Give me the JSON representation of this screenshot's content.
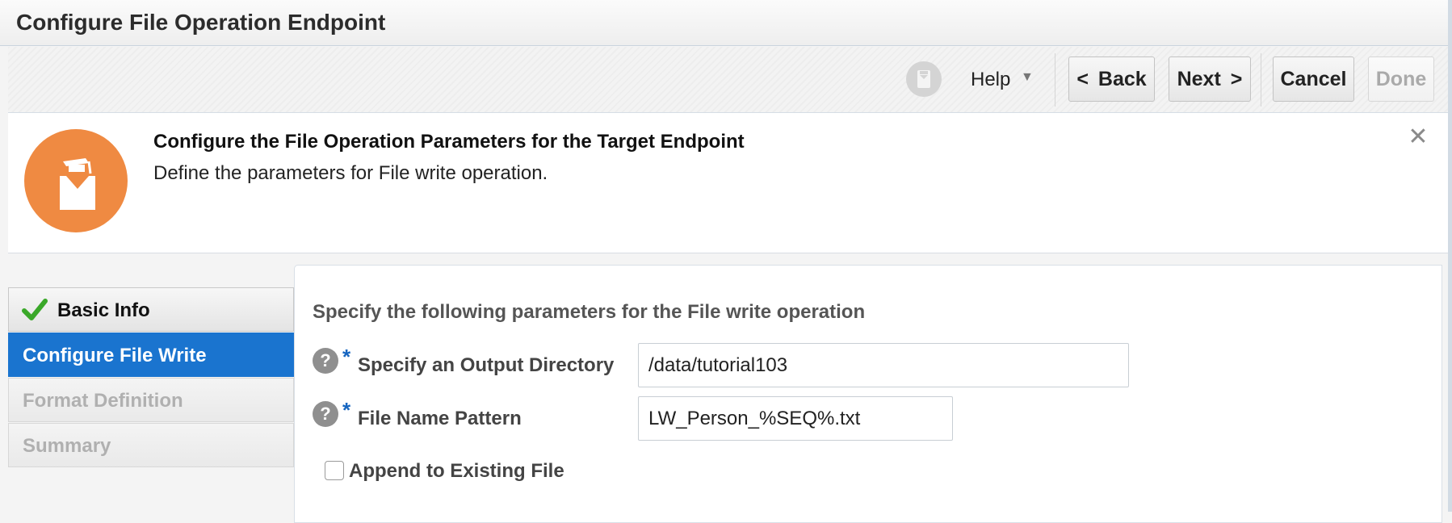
{
  "window": {
    "title": "Configure File Operation Endpoint"
  },
  "toolbar": {
    "user_icon": "user-badge-icon",
    "help_label": "Help",
    "help_caret": "▼",
    "back_label": "Back",
    "back_arrow": "<",
    "next_label": "Next",
    "next_arrow": ">",
    "cancel_label": "Cancel",
    "done_label": "Done"
  },
  "banner": {
    "icon": "graduation-cap-icon",
    "icon_color": "#ef8a42",
    "title": "Configure the File Operation Parameters for the Target Endpoint",
    "description": "Define the parameters for File write operation.",
    "close": "✕"
  },
  "steps": [
    {
      "label": "Basic Info",
      "state": "completed"
    },
    {
      "label": "Configure File Write",
      "state": "active"
    },
    {
      "label": "Format Definition",
      "state": "disabled"
    },
    {
      "label": "Summary",
      "state": "disabled"
    }
  ],
  "form": {
    "heading": "Specify the following parameters for the File write operation",
    "required_marker": "*",
    "help_glyph": "?",
    "output_directory": {
      "label": "Specify an Output Directory",
      "value": "/data/tutorial103"
    },
    "file_name_pattern": {
      "label": "File Name Pattern",
      "value": "LW_Person_%SEQ%.txt"
    },
    "append": {
      "label": "Append to Existing File",
      "checked": false
    }
  },
  "colors": {
    "accent": "#1a74cf",
    "required": "#1565c0",
    "success": "#3aa829"
  }
}
